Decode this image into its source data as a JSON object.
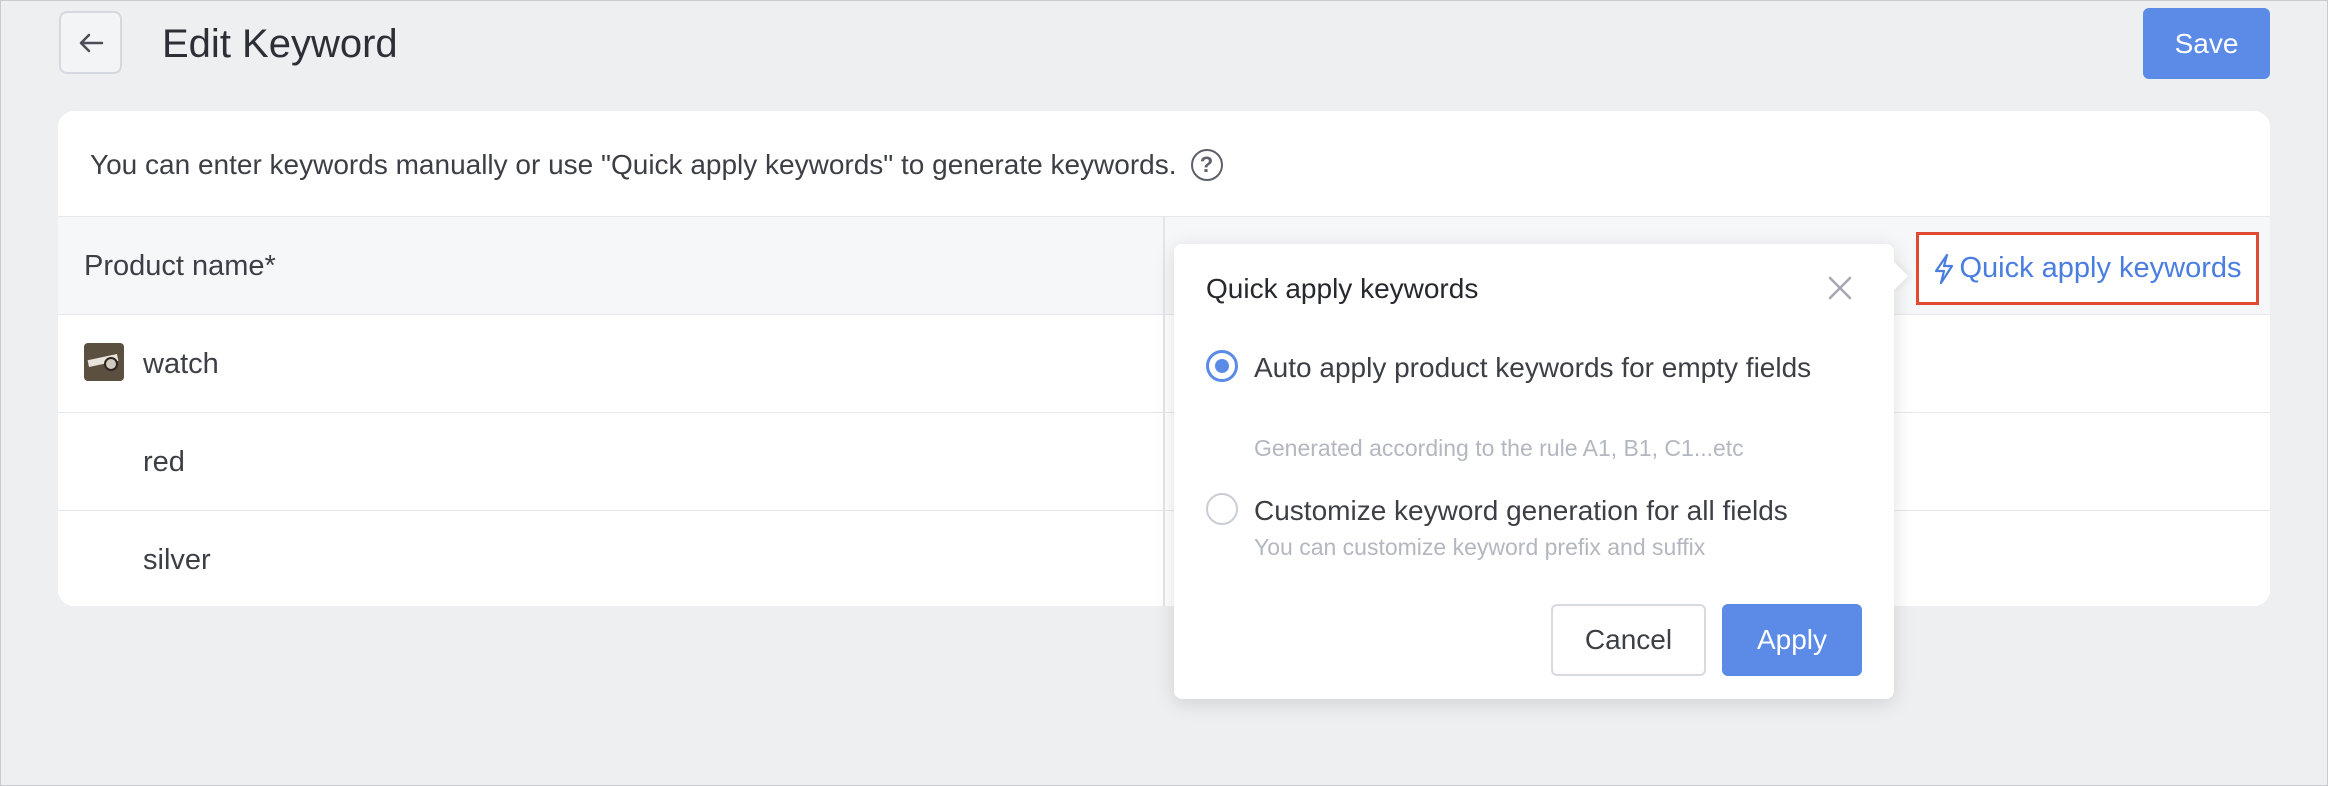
{
  "header": {
    "title": "Edit Keyword",
    "save_label": "Save"
  },
  "info": {
    "text": "You can enter keywords manually or use \"Quick apply keywords\" to generate keywords.",
    "help_glyph": "?"
  },
  "table": {
    "column_header": "Product name*",
    "rows": [
      {
        "name": "watch",
        "has_thumbnail": true
      },
      {
        "name": "red",
        "has_thumbnail": false
      },
      {
        "name": "silver",
        "has_thumbnail": false
      }
    ],
    "quick_apply_label": "Quick apply keywords"
  },
  "popover": {
    "title": "Quick apply keywords",
    "options": [
      {
        "label": "Auto apply product keywords for empty fields",
        "hint": "Generated according to the rule A1, B1, C1...etc",
        "selected": true
      },
      {
        "label": "Customize keyword generation for all fields",
        "hint": "You can customize keyword prefix and suffix",
        "selected": false
      }
    ],
    "cancel_label": "Cancel",
    "apply_label": "Apply"
  },
  "colors": {
    "accent": "#5b8be6",
    "link": "#4a7de0",
    "highlight_border": "#e04a33",
    "background": "#eeeff1"
  },
  "icons": [
    "arrow-left-icon",
    "help-circle-icon",
    "lightning-icon",
    "close-icon",
    "radio-selected-icon",
    "radio-unselected-icon"
  ]
}
